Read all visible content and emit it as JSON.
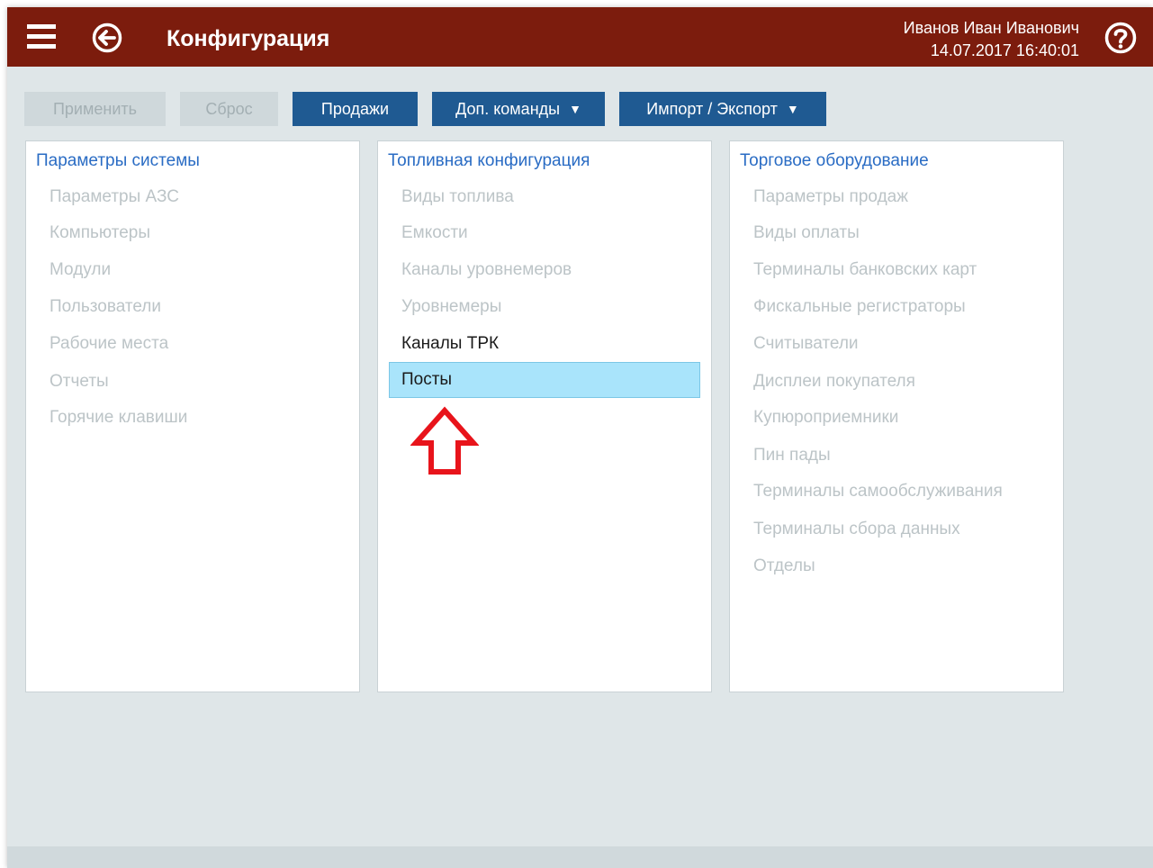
{
  "header": {
    "title": "Конфигурация",
    "user_name": "Иванов Иван Иванович",
    "datetime": "14.07.2017 16:40:01",
    "menu_icon": "hamburger-menu-icon",
    "back_icon": "back-arrow-circle-icon",
    "help_icon": "help-question-icon"
  },
  "toolbar": {
    "apply_label": "Применить",
    "reset_label": "Сброс",
    "sales_label": "Продажи",
    "extra_commands_label": "Доп. команды",
    "import_export_label": "Импорт / Экспорт",
    "dropdown_icon": "caret-down-icon"
  },
  "panels": [
    {
      "title": "Параметры системы",
      "items": [
        {
          "label": "Параметры АЗС",
          "state": "disabled"
        },
        {
          "label": "Компьютеры",
          "state": "disabled"
        },
        {
          "label": "Модули",
          "state": "disabled"
        },
        {
          "label": "Пользователи",
          "state": "disabled"
        },
        {
          "label": "Рабочие места",
          "state": "disabled"
        },
        {
          "label": "Отчеты",
          "state": "disabled"
        },
        {
          "label": "Горячие клавиши",
          "state": "disabled"
        }
      ]
    },
    {
      "title": "Топливная конфигурация",
      "items": [
        {
          "label": "Виды топлива",
          "state": "disabled"
        },
        {
          "label": "Емкости",
          "state": "disabled"
        },
        {
          "label": "Каналы уровнемеров",
          "state": "disabled"
        },
        {
          "label": "Уровнемеры",
          "state": "disabled"
        },
        {
          "label": "Каналы ТРК",
          "state": "active"
        },
        {
          "label": "Посты",
          "state": "selected"
        }
      ]
    },
    {
      "title": "Торговое оборудование",
      "items": [
        {
          "label": "Параметры продаж",
          "state": "disabled"
        },
        {
          "label": "Виды оплаты",
          "state": "disabled"
        },
        {
          "label": "Терминалы банковских карт",
          "state": "disabled"
        },
        {
          "label": "Фискальные регистраторы",
          "state": "disabled"
        },
        {
          "label": "Считыватели",
          "state": "disabled"
        },
        {
          "label": "Дисплеи покупателя",
          "state": "disabled"
        },
        {
          "label": "Купюроприемники",
          "state": "disabled"
        },
        {
          "label": "Пин пады",
          "state": "disabled"
        },
        {
          "label": "Терминалы самообслуживания",
          "state": "disabled"
        },
        {
          "label": "Терминалы сбора данных",
          "state": "disabled"
        },
        {
          "label": "Отделы",
          "state": "disabled"
        }
      ]
    }
  ],
  "annotation": {
    "icon": "red-up-arrow-icon",
    "color": "#e8141b"
  },
  "colors": {
    "header": "#7c1c0d",
    "primary_button": "#1f5a92",
    "link": "#2a6cc4",
    "selected": "#a9e4fb"
  }
}
